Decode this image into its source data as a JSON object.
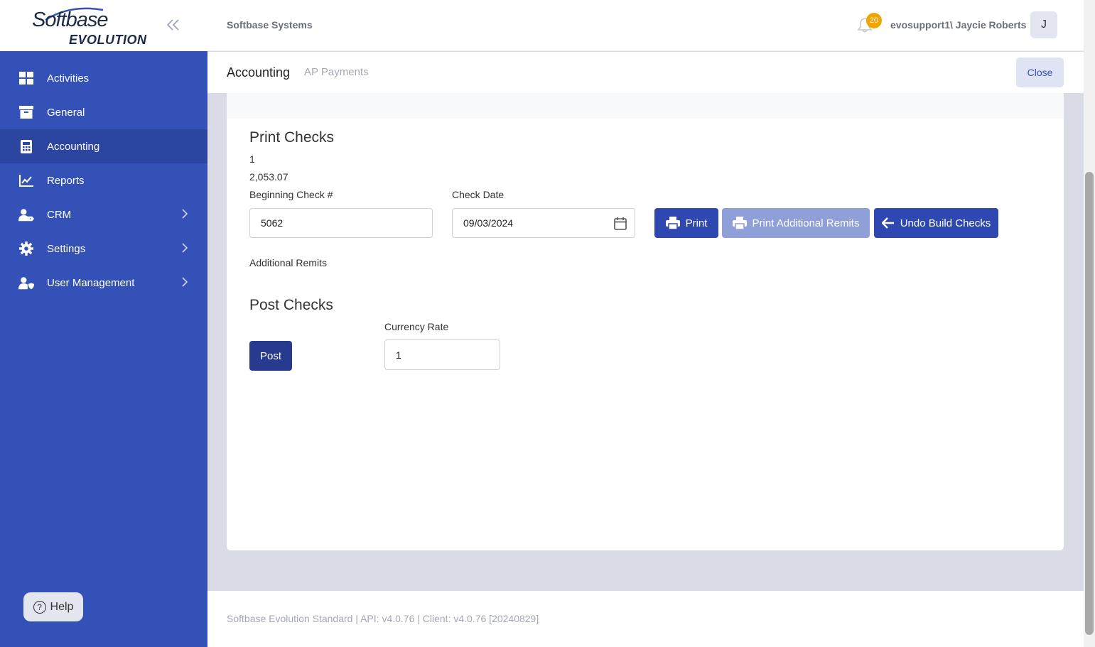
{
  "app": {
    "logo_top": "Softbase",
    "logo_bottom": "EVOLUTION"
  },
  "sidebar": {
    "items": [
      {
        "label": "Activities",
        "icon": "grid-icon"
      },
      {
        "label": "General",
        "icon": "archive-icon"
      },
      {
        "label": "Accounting",
        "icon": "calculator-icon",
        "active": true
      },
      {
        "label": "Reports",
        "icon": "chart-line-icon"
      },
      {
        "label": "CRM",
        "icon": "user-tag-icon",
        "has_submenu": true
      },
      {
        "label": "Settings",
        "icon": "gear-icon",
        "has_submenu": true
      },
      {
        "label": "User Management",
        "icon": "user-shield-icon",
        "has_submenu": true
      }
    ],
    "help_label": "Help"
  },
  "header": {
    "company": "Softbase Systems",
    "notification_count": "20",
    "user": "evosupport1\\ Jaycie Roberts",
    "avatar_initial": "J"
  },
  "subheader": {
    "title": "Accounting",
    "breadcrumb": "AP Payments",
    "close_label": "Close"
  },
  "print_checks": {
    "heading": "Print Checks",
    "count": "1",
    "total": "2,053.07",
    "beginning_check_label": "Beginning Check #",
    "beginning_check_value": "5062",
    "check_date_label": "Check Date",
    "check_date_value": "09/03/2024",
    "print_label": "Print",
    "print_remits_label": "Print Additional Remits",
    "undo_label": "Undo Build Checks",
    "additional_remits_label": "Additional Remits"
  },
  "post_checks": {
    "heading": "Post Checks",
    "post_label": "Post",
    "currency_rate_label": "Currency Rate",
    "currency_rate_value": "1"
  },
  "footer": {
    "text": "Softbase Evolution Standard | API: v4.0.76 | Client: v4.0.76 [20240829]"
  },
  "colors": {
    "sidebar": "#3451b8",
    "sidebar_active": "#2c45a0",
    "primary_button": "#2f48b1",
    "badge": "#f0a500"
  }
}
